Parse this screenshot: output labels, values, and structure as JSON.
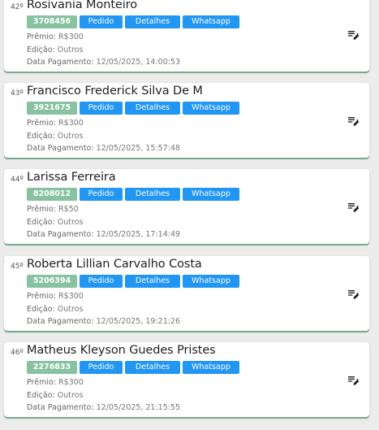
{
  "labels": {
    "premio": "Prêmio:",
    "edicao": "Edição:",
    "data_pagamento": "Data Pagamento:",
    "pedido": "Pedido",
    "detalhes": "Detalhes",
    "whatsapp": "Whatsapp"
  },
  "icons": {
    "edit": "edit-list-icon"
  },
  "colors": {
    "code_chip": "#88c2a0",
    "button": "#2196f3",
    "card_accent": "#7aa88e"
  },
  "entries": [
    {
      "position": "42º",
      "name": "Rosivania Monteiro",
      "code": "3708456",
      "premio": "R$300",
      "edicao": "Outros",
      "data_pagamento": "12/05/2025, 14:00:53"
    },
    {
      "position": "43º",
      "name": "Francisco Frederick Silva De M",
      "code": "3921675",
      "premio": "R$300",
      "edicao": "Outros",
      "data_pagamento": "12/05/2025, 15:57:48"
    },
    {
      "position": "44º",
      "name": "Larissa Ferreira",
      "code": "8208012",
      "premio": "R$50",
      "edicao": "Outros",
      "data_pagamento": "12/05/2025, 17:14:49"
    },
    {
      "position": "45º",
      "name": "Roberta Lillian Carvalho Costa",
      "code": "5206394",
      "premio": "R$300",
      "edicao": "Outros",
      "data_pagamento": "12/05/2025, 19:21:26"
    },
    {
      "position": "46º",
      "name": "Matheus Kleyson Guedes Pristes",
      "code": "2276833",
      "premio": "R$300",
      "edicao": "Outros",
      "data_pagamento": "12/05/2025, 21:15:55"
    }
  ]
}
